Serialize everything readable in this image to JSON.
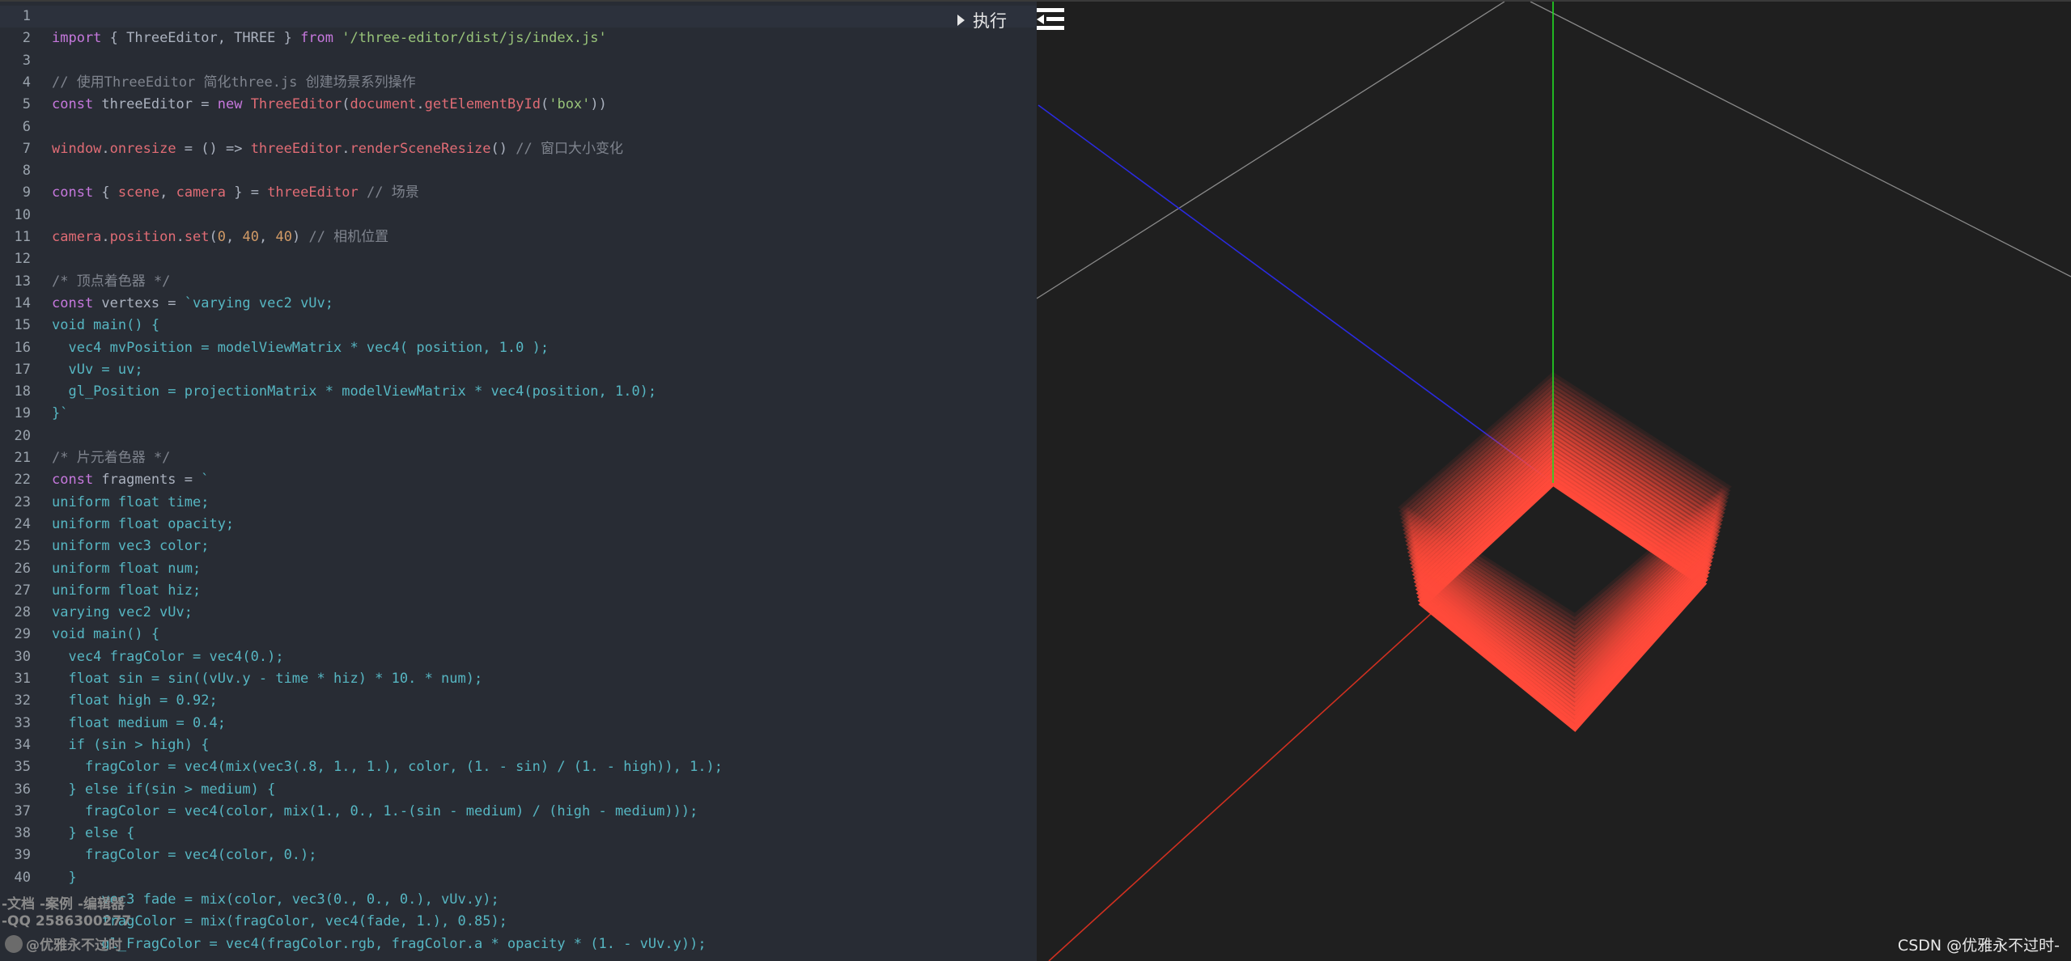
{
  "toolbar": {
    "run_label": "执行",
    "run_icon": "play-triangle-icon",
    "menu_icon": "collapse-menu-icon"
  },
  "editor": {
    "lines": [
      {
        "n": "1",
        "segments": []
      },
      {
        "n": "2",
        "segments": [
          {
            "t": "import",
            "c": "kw"
          },
          {
            "t": " { ThreeEditor, THREE } ",
            "c": "pl"
          },
          {
            "t": "from",
            "c": "kw"
          },
          {
            "t": " ",
            "c": "pl"
          },
          {
            "t": "'/three-editor/dist/js/index.js'",
            "c": "str"
          }
        ]
      },
      {
        "n": "3",
        "segments": []
      },
      {
        "n": "4",
        "segments": [
          {
            "t": "// 使用ThreeEditor 简化three.js 创建场景系列操作",
            "c": "cm"
          }
        ]
      },
      {
        "n": "5",
        "segments": [
          {
            "t": "const",
            "c": "kw"
          },
          {
            "t": " threeEditor = ",
            "c": "pl"
          },
          {
            "t": "new",
            "c": "kw"
          },
          {
            "t": " ",
            "c": "pl"
          },
          {
            "t": "ThreeEditor",
            "c": "fn"
          },
          {
            "t": "(",
            "c": "pl"
          },
          {
            "t": "document",
            "c": "fn"
          },
          {
            "t": ".",
            "c": "pl"
          },
          {
            "t": "getElementById",
            "c": "fn"
          },
          {
            "t": "(",
            "c": "pl"
          },
          {
            "t": "'box'",
            "c": "str"
          },
          {
            "t": "))",
            "c": "pl"
          }
        ]
      },
      {
        "n": "6",
        "segments": []
      },
      {
        "n": "7",
        "segments": [
          {
            "t": "window",
            "c": "fn"
          },
          {
            "t": ".",
            "c": "pl"
          },
          {
            "t": "onresize",
            "c": "fn"
          },
          {
            "t": " = () => ",
            "c": "pl"
          },
          {
            "t": "threeEditor",
            "c": "fn"
          },
          {
            "t": ".",
            "c": "pl"
          },
          {
            "t": "renderSceneResize",
            "c": "fn"
          },
          {
            "t": "() ",
            "c": "pl"
          },
          {
            "t": "// 窗口大小变化",
            "c": "cm"
          }
        ]
      },
      {
        "n": "8",
        "segments": []
      },
      {
        "n": "9",
        "segments": [
          {
            "t": "const",
            "c": "kw"
          },
          {
            "t": " { ",
            "c": "pl"
          },
          {
            "t": "scene",
            "c": "fn"
          },
          {
            "t": ", ",
            "c": "pl"
          },
          {
            "t": "camera",
            "c": "fn"
          },
          {
            "t": " } = ",
            "c": "pl"
          },
          {
            "t": "threeEditor",
            "c": "fn"
          },
          {
            "t": " ",
            "c": "pl"
          },
          {
            "t": "// 场景",
            "c": "cm"
          }
        ]
      },
      {
        "n": "10",
        "segments": []
      },
      {
        "n": "11",
        "segments": [
          {
            "t": "camera",
            "c": "fn"
          },
          {
            "t": ".",
            "c": "pl"
          },
          {
            "t": "position",
            "c": "fn"
          },
          {
            "t": ".",
            "c": "pl"
          },
          {
            "t": "set",
            "c": "fn"
          },
          {
            "t": "(",
            "c": "pl"
          },
          {
            "t": "0",
            "c": "num"
          },
          {
            "t": ", ",
            "c": "pl"
          },
          {
            "t": "40",
            "c": "num"
          },
          {
            "t": ", ",
            "c": "pl"
          },
          {
            "t": "40",
            "c": "num"
          },
          {
            "t": ") ",
            "c": "pl"
          },
          {
            "t": "// 相机位置",
            "c": "cm"
          }
        ]
      },
      {
        "n": "12",
        "segments": []
      },
      {
        "n": "13",
        "segments": [
          {
            "t": "/* 顶点着色器 */",
            "c": "cm"
          }
        ]
      },
      {
        "n": "14",
        "segments": [
          {
            "t": "const",
            "c": "kw"
          },
          {
            "t": " vertexs = ",
            "c": "pl"
          },
          {
            "t": "`varying vec2 vUv;",
            "c": "sh"
          }
        ]
      },
      {
        "n": "15",
        "segments": [
          {
            "t": "void main() {",
            "c": "sh"
          }
        ]
      },
      {
        "n": "16",
        "segments": [
          {
            "t": "  vec4 mvPosition = modelViewMatrix * vec4( position, 1.0 );",
            "c": "sh"
          }
        ]
      },
      {
        "n": "17",
        "segments": [
          {
            "t": "  vUv = uv;",
            "c": "sh"
          }
        ]
      },
      {
        "n": "18",
        "segments": [
          {
            "t": "  gl_Position = projectionMatrix * modelViewMatrix * vec4(position, 1.0);",
            "c": "sh"
          }
        ]
      },
      {
        "n": "19",
        "segments": [
          {
            "t": "}`",
            "c": "sh"
          }
        ]
      },
      {
        "n": "20",
        "segments": []
      },
      {
        "n": "21",
        "segments": [
          {
            "t": "/* 片元着色器 */",
            "c": "cm"
          }
        ]
      },
      {
        "n": "22",
        "segments": [
          {
            "t": "const",
            "c": "kw"
          },
          {
            "t": " fragments = ",
            "c": "pl"
          },
          {
            "t": "`",
            "c": "sh"
          }
        ]
      },
      {
        "n": "23",
        "segments": [
          {
            "t": "uniform float time;",
            "c": "sh"
          }
        ]
      },
      {
        "n": "24",
        "segments": [
          {
            "t": "uniform float opacity;",
            "c": "sh"
          }
        ]
      },
      {
        "n": "25",
        "segments": [
          {
            "t": "uniform vec3 color;",
            "c": "sh"
          }
        ]
      },
      {
        "n": "26",
        "segments": [
          {
            "t": "uniform float num;",
            "c": "sh"
          }
        ]
      },
      {
        "n": "27",
        "segments": [
          {
            "t": "uniform float hiz;",
            "c": "sh"
          }
        ]
      },
      {
        "n": "28",
        "segments": [
          {
            "t": "varying vec2 vUv;",
            "c": "sh"
          }
        ]
      },
      {
        "n": "29",
        "segments": [
          {
            "t": "void main() {",
            "c": "sh"
          }
        ]
      },
      {
        "n": "30",
        "segments": [
          {
            "t": "  vec4 fragColor = vec4(0.);",
            "c": "sh"
          }
        ]
      },
      {
        "n": "31",
        "segments": [
          {
            "t": "  float sin = sin((vUv.y - time * hiz) * 10. * num);",
            "c": "sh"
          }
        ]
      },
      {
        "n": "32",
        "segments": [
          {
            "t": "  float high = 0.92;",
            "c": "sh"
          }
        ]
      },
      {
        "n": "33",
        "segments": [
          {
            "t": "  float medium = 0.4;",
            "c": "sh"
          }
        ]
      },
      {
        "n": "34",
        "segments": [
          {
            "t": "  if (sin > high) {",
            "c": "sh"
          }
        ]
      },
      {
        "n": "35",
        "segments": [
          {
            "t": "    fragColor = vec4(mix(vec3(.8, 1., 1.), color, (1. - sin) / (1. - high)), 1.);",
            "c": "sh"
          }
        ]
      },
      {
        "n": "36",
        "segments": [
          {
            "t": "  } else if(sin > medium) {",
            "c": "sh"
          }
        ]
      },
      {
        "n": "37",
        "segments": [
          {
            "t": "    fragColor = vec4(color, mix(1., 0., 1.-(sin - medium) / (high - medium)));",
            "c": "sh"
          }
        ]
      },
      {
        "n": "38",
        "segments": [
          {
            "t": "  } else {",
            "c": "sh"
          }
        ]
      },
      {
        "n": "39",
        "segments": [
          {
            "t": "    fragColor = vec4(color, 0.);",
            "c": "sh"
          }
        ]
      },
      {
        "n": "40",
        "segments": [
          {
            "t": "  }",
            "c": "sh"
          }
        ]
      },
      {
        "n": "",
        "segments": [
          {
            "t": "      vec3 fade = mix(color, vec3(0., 0., 0.), vUv.y);",
            "c": "sh"
          }
        ]
      },
      {
        "n": "",
        "segments": [
          {
            "t": "      fragColor = mix(fragColor, vec4(fade, 1.), 0.85);",
            "c": "sh"
          }
        ]
      },
      {
        "n": "",
        "segments": [
          {
            "t": "      gl_FragColor = vec4(fragColor.rgb, fragColor.a * opacity * (1. - vUv.y));",
            "c": "sh"
          }
        ]
      }
    ]
  },
  "watermarks": {
    "line1": "-文档 -案例 -编辑器",
    "line2": "-QQ 2586300277",
    "line3": "@优雅永不过时"
  },
  "credit": "CSDN @优雅永不过时-",
  "scene": {
    "mesh_color": "#ff4a3a",
    "axis_x_color": "#e03a2a",
    "axis_y_color": "#22dd22",
    "axis_z_color": "#2a2ae0",
    "grid_color": "#9a9a9a"
  }
}
